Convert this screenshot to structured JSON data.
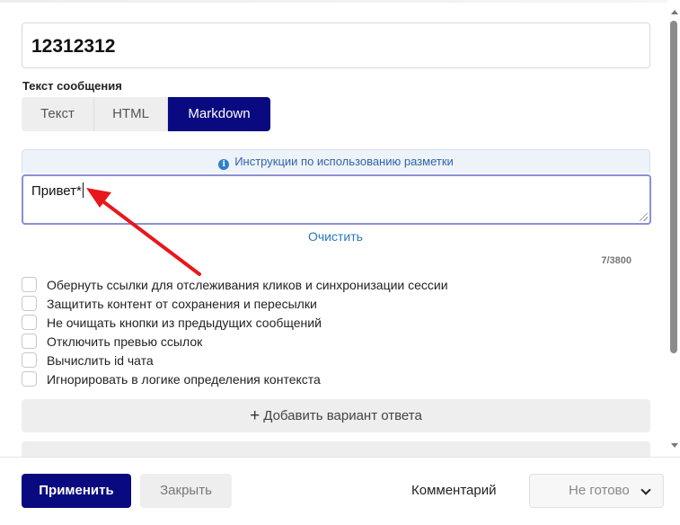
{
  "title_field": {
    "value": "12312312"
  },
  "message_section": {
    "label": "Текст сообщения",
    "format_tabs": [
      {
        "label": "Текст",
        "active": false
      },
      {
        "label": "HTML",
        "active": false
      },
      {
        "label": "Markdown",
        "active": true
      }
    ],
    "instructions_link": "Инструкции по использованию разметки",
    "textarea_value": "Привет*",
    "clear_label": "Очистить",
    "char_count": "7/3800"
  },
  "options": [
    {
      "label": "Обернуть ссылки для отслеживания кликов и синхронизации сессии",
      "checked": false
    },
    {
      "label": "Защитить контент от сохранения и пересылки",
      "checked": false
    },
    {
      "label": "Не очищать кнопки из предыдущих сообщений",
      "checked": false
    },
    {
      "label": "Отключить превью ссылок",
      "checked": false
    },
    {
      "label": "Вычислить id чата",
      "checked": false
    },
    {
      "label": "Игнорировать в логике определения контекста",
      "checked": false
    }
  ],
  "add_answer": {
    "icon": "plus-icon",
    "label": "Добавить вариант ответа"
  },
  "footer": {
    "apply_label": "Применить",
    "close_label": "Закрыть",
    "comment_label": "Комментарий",
    "status_value": "Не готово"
  },
  "colors": {
    "primary": "#0a0a80",
    "link": "#2a78c2",
    "annotation_arrow": "#e8171c"
  }
}
